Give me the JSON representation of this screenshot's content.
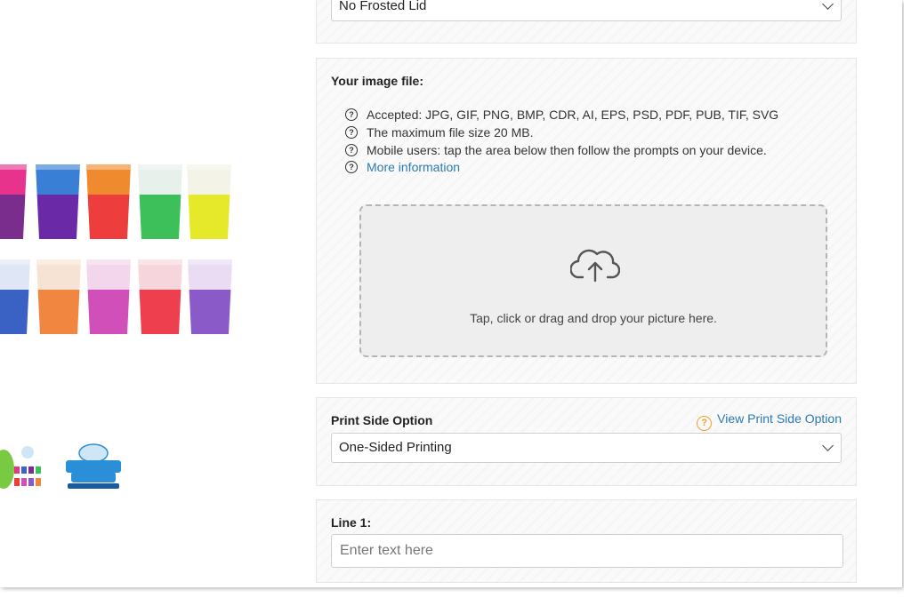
{
  "frosted_lid": {
    "selected": "No Frosted Lid"
  },
  "image_upload": {
    "title": "Your image file:",
    "info": [
      {
        "text": "Accepted: JPG, GIF, PNG, BMP, CDR, AI, EPS, PSD, PDF, PUB, TIF, SVG",
        "link": false
      },
      {
        "text": "The maximum file size 20 MB.",
        "link": false
      },
      {
        "text": "Mobile users: tap the area below then follow the prompts on your device.",
        "link": false
      },
      {
        "text": "More information",
        "link": true
      }
    ],
    "dropzone_hint": "Tap, click or drag and drop your picture here."
  },
  "print_side": {
    "label": "Print Side Option",
    "view_link": "View Print Side Option",
    "selected": "One-Sided Printing"
  },
  "line1": {
    "label": "Line 1:",
    "placeholder": "Enter text here"
  },
  "colors": {
    "accent_link": "#2a7ab0",
    "help_icon": "#f0a030"
  }
}
